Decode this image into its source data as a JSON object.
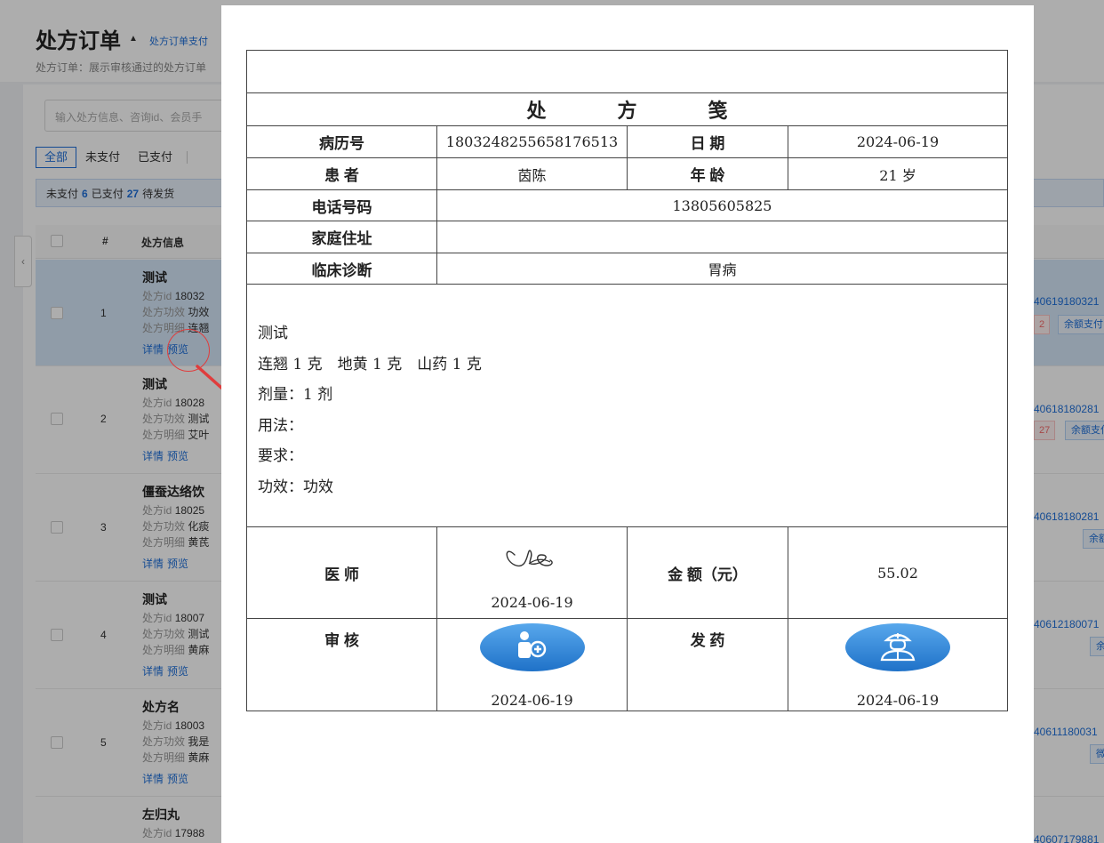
{
  "page": {
    "title": "处方订单",
    "title_link": "处方订单支付",
    "subtitle": "处方订单：展示审核通过的处方订单"
  },
  "search": {
    "placeholder": "输入处方信息、咨询id、会员手"
  },
  "tabs": [
    "全部",
    "未支付",
    "已支付"
  ],
  "stats": {
    "unpaid_label": "未支付",
    "unpaid_count": "6",
    "paid_label": "已支付",
    "paid_count": "27",
    "pending_label": "待发货"
  },
  "table": {
    "headers": {
      "index": "#",
      "info": "处方信息"
    },
    "rows": [
      {
        "index": "1",
        "name": "测试",
        "id_label": "处方id",
        "id": "18032",
        "effect_label": "处方功效",
        "effect": "功效",
        "detail_label": "处方明细",
        "detail": "连翘",
        "link_detail": "详情",
        "link_preview": "预览",
        "order_id": "40619180321",
        "tag_left": "2",
        "tag_right": "余额支付"
      },
      {
        "index": "2",
        "name": "测试",
        "id_label": "处方id",
        "id": "18028",
        "effect_label": "处方功效",
        "effect": "测试",
        "detail_label": "处方明细",
        "detail": "艾叶",
        "link_detail": "详情",
        "link_preview": "预览",
        "order_id": "40618180281",
        "tag_left": "27",
        "tag_right": "余额支付"
      },
      {
        "index": "3",
        "name": "僵蚕达络饮",
        "id_label": "处方id",
        "id": "18025",
        "effect_label": "处方功效",
        "effect": "化痰",
        "detail_label": "处方明细",
        "detail": "黄芪",
        "link_detail": "详情",
        "link_preview": "预览",
        "order_id": "40618180281",
        "tag_left": "",
        "tag_right": "余额支付"
      },
      {
        "index": "4",
        "name": "测试",
        "id_label": "处方id",
        "id": "18007",
        "effect_label": "处方功效",
        "effect": "测试",
        "detail_label": "处方明细",
        "detail": "黄麻",
        "link_detail": "详情",
        "link_preview": "预览",
        "order_id": "40612180071",
        "tag_left": "",
        "tag_right": "余额支付"
      },
      {
        "index": "5",
        "name": "处方名",
        "id_label": "处方id",
        "id": "18003",
        "effect_label": "处方功效",
        "effect": "我是",
        "detail_label": "处方明细",
        "detail": "黄麻",
        "link_detail": "详情",
        "link_preview": "预览",
        "order_id": "40611180031",
        "tag_left": "",
        "tag_right": "微信"
      },
      {
        "index": "",
        "name": "左归丸",
        "id_label": "处方id",
        "id": "17988",
        "order_id": "40607179881"
      }
    ]
  },
  "prescription": {
    "title_chars": [
      "处",
      "方",
      "笺"
    ],
    "record_no_label": "病历号",
    "record_no": "1803248255658176513",
    "date_label": "日 期",
    "date": "2024-06-19",
    "patient_label": "患 者",
    "patient": "茵陈",
    "age_label": "年 龄",
    "age": "21 岁",
    "phone_label": "电话号码",
    "phone": "13805605825",
    "address_label": "家庭住址",
    "address": "",
    "diagnosis_label": "临床诊断",
    "diagnosis": "胃病",
    "body": {
      "name": "测试",
      "herbs": "连翘 1 克　地黄 1 克　山药 1 克",
      "dose": "剂量：1 剂",
      "usage": "用法：",
      "requirement": "要求：",
      "effect": "功效：功效"
    },
    "doctor_label": "医 师",
    "doctor_date": "2024-06-19",
    "amount_label": "金 额（元）",
    "amount": "55.02",
    "audit_label": "审 核",
    "audit_date": "2024-06-19",
    "dispense_label": "发 药",
    "dispense_date": "2024-06-19"
  },
  "colors": {
    "accent": "#1e6fd9",
    "stamp_blue": "#2f86d8",
    "annotation_red": "#e03c3c"
  },
  "icons": [
    "pharmacist-stamp-icon",
    "doctor-stamp-icon",
    "signature-icon",
    "chevron-left-icon"
  ]
}
